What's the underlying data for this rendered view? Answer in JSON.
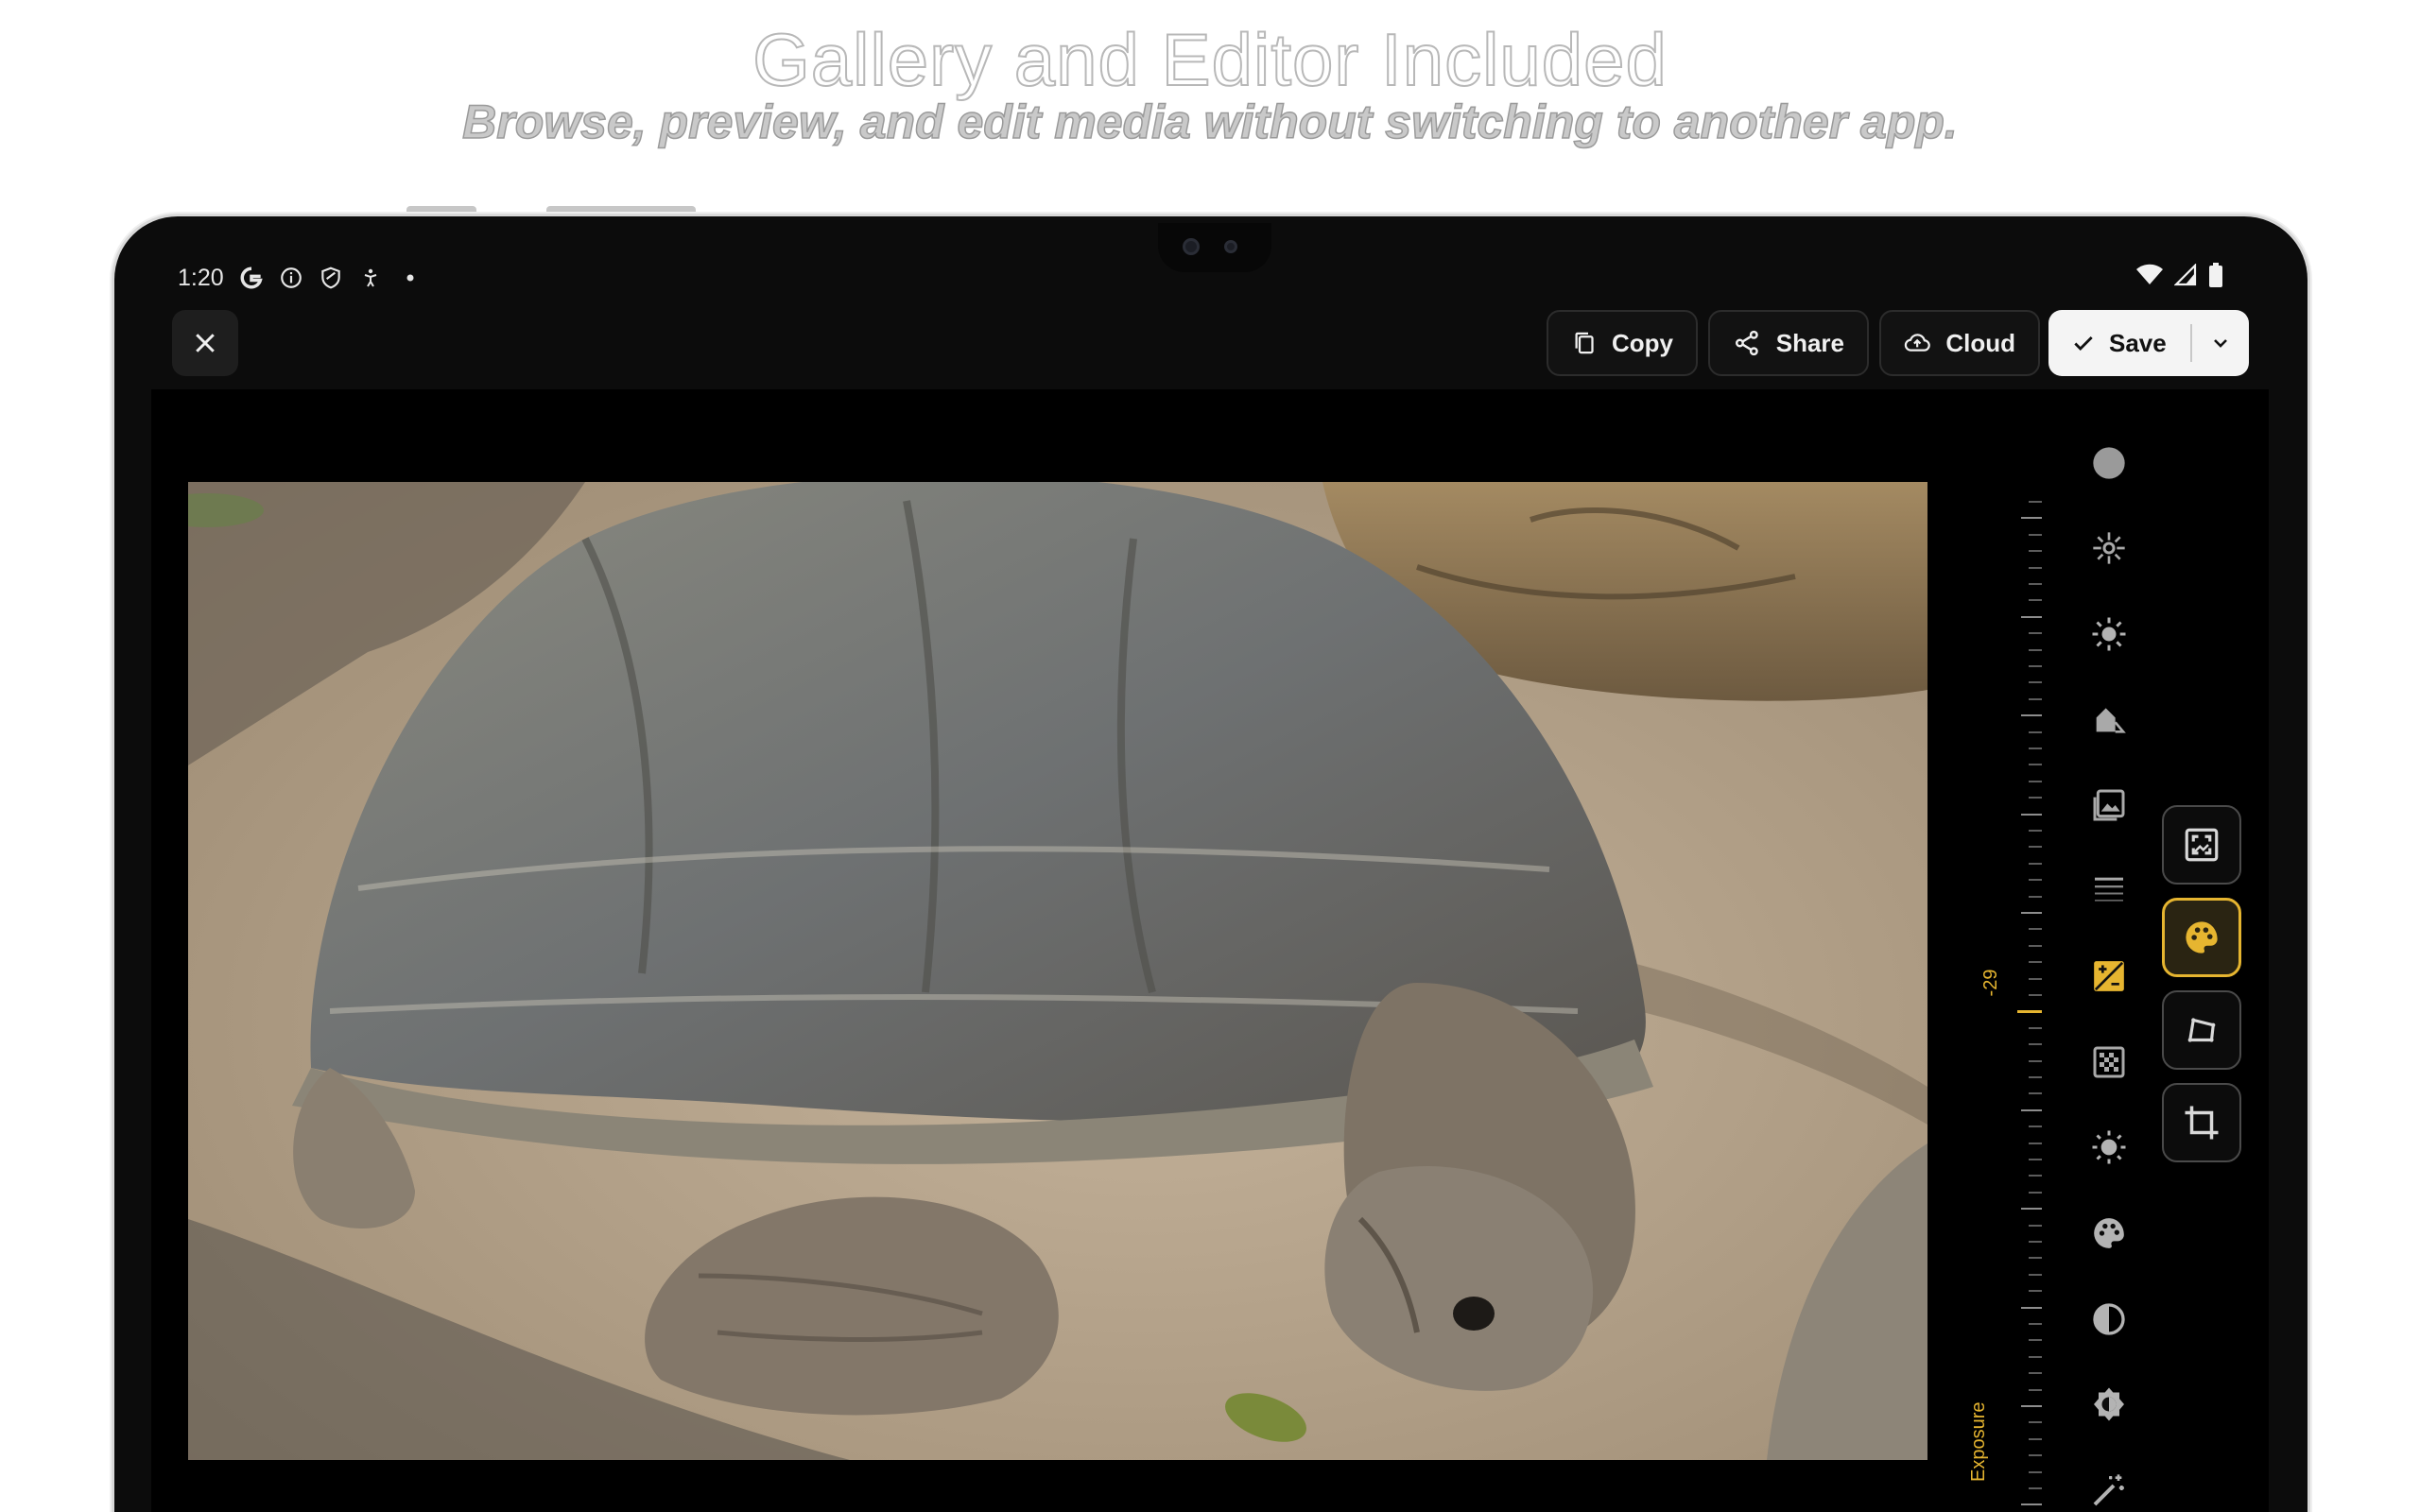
{
  "promo": {
    "title": "Gallery and Editor Included",
    "subtitle": "Browse, preview, and edit media without switching to another app."
  },
  "status_bar": {
    "time": "1:20",
    "left_icons": [
      "google-g-icon",
      "info-icon",
      "shield-icon",
      "accessibility-icon",
      "dot-icon"
    ],
    "right_icons": [
      "wifi-icon",
      "signal-icon",
      "battery-icon"
    ]
  },
  "toolbar": {
    "close_icon": "close-icon",
    "copy_label": "Copy",
    "share_label": "Share",
    "cloud_label": "Cloud",
    "save_label": "Save"
  },
  "exposure": {
    "label": "Exposure",
    "value": "-29"
  },
  "tools": [
    {
      "name": "auto",
      "icon": "circle-icon"
    },
    {
      "name": "highlights",
      "icon": "sparkle-icon"
    },
    {
      "name": "brightness",
      "icon": "sun-icon"
    },
    {
      "name": "shadows",
      "icon": "shadow-house-icon"
    },
    {
      "name": "image-adjust",
      "icon": "image-icon"
    },
    {
      "name": "grain",
      "icon": "dots-grid-icon"
    },
    {
      "name": "exposure",
      "icon": "exposure-plus-minus-icon",
      "active": true
    },
    {
      "name": "vignette",
      "icon": "checker-icon"
    },
    {
      "name": "warmth",
      "icon": "sun-small-icon"
    },
    {
      "name": "color",
      "icon": "palette-icon"
    },
    {
      "name": "contrast",
      "icon": "contrast-icon"
    },
    {
      "name": "tone",
      "icon": "gear-sun-icon"
    },
    {
      "name": "magic",
      "icon": "magic-wand-icon"
    }
  ],
  "modes": [
    {
      "name": "fit",
      "icon": "fit-screen-icon"
    },
    {
      "name": "adjust",
      "icon": "palette-icon",
      "active": true
    },
    {
      "name": "perspective",
      "icon": "perspective-icon"
    },
    {
      "name": "crop",
      "icon": "crop-icon"
    }
  ],
  "colors": {
    "accent": "#e6b530",
    "background": "#0c0c0c"
  }
}
